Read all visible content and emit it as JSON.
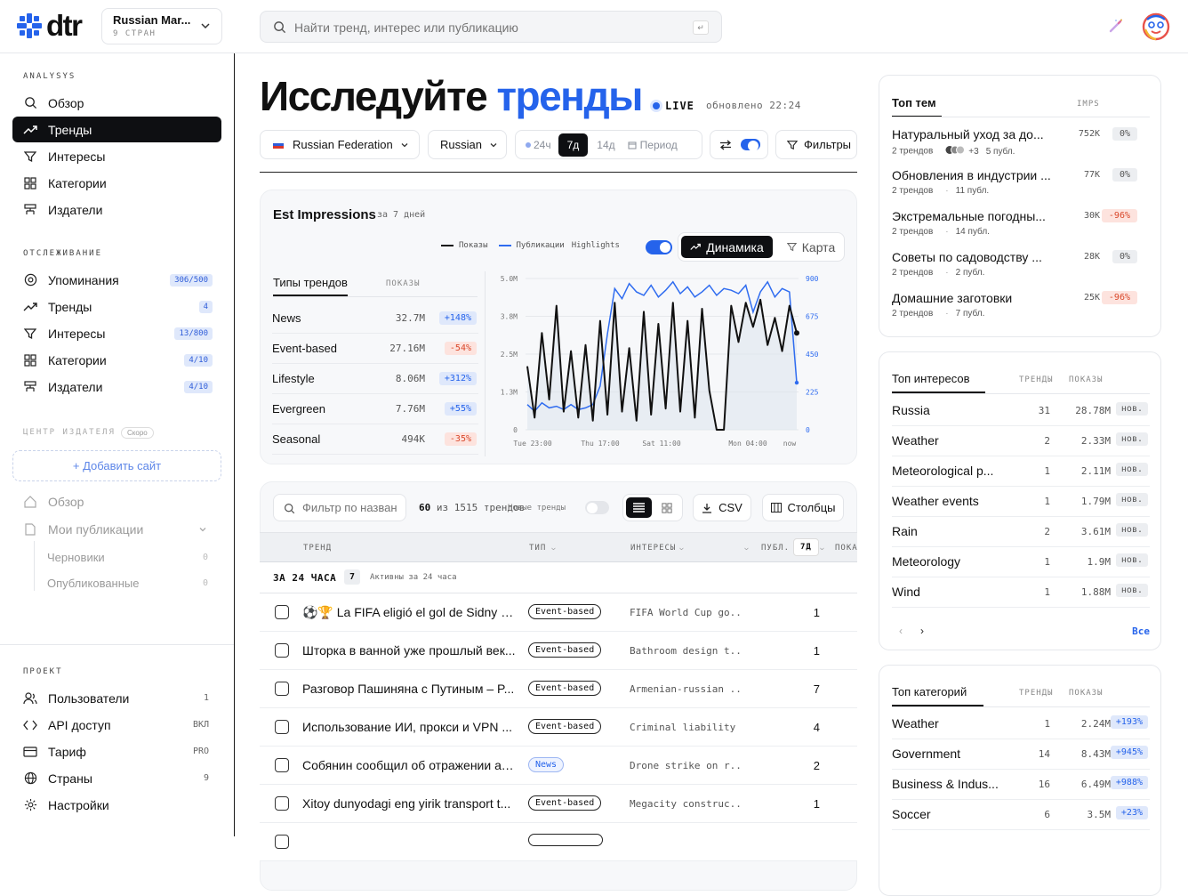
{
  "header": {
    "logo_text": "dtr",
    "project_name": "Russian Mar...",
    "project_sub": "9 СТРАН",
    "search_placeholder": "Найти тренд, интерес или публикацию",
    "search_kbd": "↵"
  },
  "sidebar": {
    "analysis_title": "ANALYSYS",
    "analysis": [
      {
        "label": "Обзор",
        "icon": "search-icon"
      },
      {
        "label": "Тренды",
        "icon": "trend-icon",
        "active": true
      },
      {
        "label": "Интересы",
        "icon": "filter-icon"
      },
      {
        "label": "Категории",
        "icon": "grid-icon"
      },
      {
        "label": "Издатели",
        "icon": "publisher-icon"
      }
    ],
    "tracking_title": "ОТСЛЕЖИВАНИЕ",
    "tracking": [
      {
        "label": "Упоминания",
        "badge": "306/500"
      },
      {
        "label": "Тренды",
        "badge": "4"
      },
      {
        "label": "Интересы",
        "badge": "13/800"
      },
      {
        "label": "Категории",
        "badge": "4/10"
      },
      {
        "label": "Издатели",
        "badge": "4/10"
      }
    ],
    "publisher_title": "ЦЕНТР ИЗДАТЕЛЯ",
    "publisher_soon": "Скоро",
    "add_site": "+ Добавить сайт",
    "pub_overview": "Обзор",
    "pub_my": "Мои публикации",
    "pub_drafts": "Черновики",
    "pub_drafts_count": "0",
    "pub_published": "Опубликованные",
    "pub_published_count": "0",
    "project_title": "ПРОЕКТ",
    "project": [
      {
        "label": "Пользователи",
        "meta": "1"
      },
      {
        "label": "API доступ",
        "meta": "ВКЛ"
      },
      {
        "label": "Тариф",
        "meta": "PRO"
      },
      {
        "label": "Страны",
        "meta": "9"
      },
      {
        "label": "Настройки",
        "meta": ""
      }
    ]
  },
  "main": {
    "title_a": "Исследуйте",
    "title_b": "тренды",
    "live": "LIVE",
    "updated": "обновлено 22:24",
    "country": "Russian Federation",
    "language": "Russian",
    "periods": [
      "24ч",
      "7д",
      "14д",
      "Период"
    ],
    "active_period": "7д",
    "filters": "Фильтры",
    "chart_card": {
      "title": "Est Impressions",
      "sub": "за 7 дней",
      "legend_shows": "Показы",
      "legend_pubs": "Публикации",
      "highlights": "Highlights",
      "btn_dynamics": "Динамика",
      "btn_map": "Карта",
      "types_tab": "Типы трендов",
      "types_col": "ПОКАЗЫ",
      "types": [
        {
          "name": "News",
          "value": "32.7M",
          "delta": "+148%",
          "dir": "up"
        },
        {
          "name": "Event-based",
          "value": "27.16M",
          "delta": "-54%",
          "dir": "dn"
        },
        {
          "name": "Lifestyle",
          "value": "8.06M",
          "delta": "+312%",
          "dir": "up"
        },
        {
          "name": "Evergreen",
          "value": "7.76M",
          "delta": "+55%",
          "dir": "up"
        },
        {
          "name": "Seasonal",
          "value": "494K",
          "delta": "-35%",
          "dir": "dn"
        }
      ]
    },
    "chart_data": {
      "type": "line",
      "y_left_ticks": [
        "5.0M",
        "3.8M",
        "2.5M",
        "1.3M",
        "0"
      ],
      "y_right_ticks": [
        "900",
        "675",
        "450",
        "225",
        "0"
      ],
      "x_ticks": [
        "Tue 23:00",
        "Thu 17:00",
        "Sat 11:00",
        "Mon 04:00",
        "now"
      ],
      "y_left_lim": [
        0,
        5000000
      ],
      "y_right_lim": [
        0,
        900
      ],
      "series": [
        {
          "name": "Показы",
          "axis": "left",
          "color": "#111111",
          "values": [
            2.1,
            0.4,
            3.2,
            1.0,
            4.1,
            0.6,
            2.6,
            0.4,
            2.8,
            0.3,
            3.6,
            0.5,
            4.2,
            0.6,
            2.7,
            0.3,
            3.9,
            0.5,
            3.5,
            0.7,
            4.2,
            0.6,
            3.6,
            0.4,
            4.0,
            1.3,
            0.0,
            0.0,
            4.1,
            2.9,
            4.2,
            3.4,
            4.3,
            2.8,
            3.7,
            2.6,
            4.1,
            3.2
          ]
        },
        {
          "name": "Публикации",
          "axis": "right",
          "color": "#2f6cf0",
          "values": [
            150,
            110,
            160,
            130,
            140,
            120,
            150,
            120,
            130,
            150,
            260,
            570,
            840,
            780,
            870,
            820,
            800,
            860,
            790,
            830,
            880,
            810,
            850,
            790,
            820,
            860,
            800,
            840,
            830,
            810,
            860,
            700,
            820,
            880,
            790,
            840,
            820,
            280
          ]
        }
      ]
    },
    "table": {
      "filter_placeholder": "Фильтр по назван",
      "count_a": "60",
      "count_mid": "из",
      "count_b": "1515",
      "count_label": "трендов",
      "new_trends": "Новые тренды",
      "csv": "CSV",
      "columns_btn": "Столбцы",
      "head_trend": "ТРЕНД",
      "head_type": "ТИП",
      "head_interests": "ИНТЕРЕСЫ",
      "head_pubs": "ПУБЛ.",
      "head_period": "7Д",
      "head_shows": "ПОКА",
      "group_label": "ЗА 24 ЧАСА",
      "group_count": "7",
      "group_sub": "Активны за 24 часа",
      "rows": [
        {
          "title": "⚽🏆 La FIFA eligió el gol de Sidny L...",
          "type": "Event-based",
          "interest": "FIFA World Cup go...",
          "pubs": "1"
        },
        {
          "title": "Шторка в ванной уже прошлый век...",
          "type": "Event-based",
          "interest": "Bathroom design t...",
          "pubs": "1"
        },
        {
          "title": "Разговор Пашиняна с Путиным – P...",
          "type": "Event-based",
          "interest": "Armenian-russian ...",
          "pubs": "7"
        },
        {
          "title": "Использование ИИ, прокси и VPN ...",
          "type": "Event-based",
          "interest": "Criminal liability",
          "pubs": "4"
        },
        {
          "title": "Собянин сообщил об отражении ат...",
          "type": "News",
          "interest": "Drone strike on r...",
          "pubs": "2"
        },
        {
          "title": "Xitoy dunyodagi eng yirik transport t...",
          "type": "Event-based",
          "interest": "Megacity construc...",
          "pubs": "1"
        }
      ]
    }
  },
  "right": {
    "topics": {
      "tab": "Топ тем",
      "col": "IMPS",
      "items": [
        {
          "title": "Натуральный уход за до...",
          "meta_a": "2 трендов",
          "meta_extra": "+3",
          "meta_b": "5 публ.",
          "imps": "752K",
          "delta": "0%",
          "dir": "gr"
        },
        {
          "title": "Обновления в индустрии ...",
          "meta_a": "2 трендов",
          "meta_extra": "",
          "meta_b": "11 публ.",
          "imps": "77K",
          "delta": "0%",
          "dir": "gr"
        },
        {
          "title": "Экстремальные погодны...",
          "meta_a": "2 трендов",
          "meta_extra": "",
          "meta_b": "14 публ.",
          "imps": "30K",
          "delta": "-96%",
          "dir": "dn"
        },
        {
          "title": "Советы по садоводству ...",
          "meta_a": "2 трендов",
          "meta_extra": "",
          "meta_b": "2 публ.",
          "imps": "28K",
          "delta": "0%",
          "dir": "gr"
        },
        {
          "title": "Домашние заготовки",
          "meta_a": "2 трендов",
          "meta_extra": "",
          "meta_b": "7 публ.",
          "imps": "25K",
          "delta": "-96%",
          "dir": "dn"
        }
      ]
    },
    "interests": {
      "tab": "Топ интересов",
      "col_trends": "ТРЕНДЫ",
      "col_shows": "ПОКАЗЫ",
      "all": "Все",
      "items": [
        {
          "name": "Russia",
          "trends": "31",
          "shows": "28.78M",
          "badge": "нов."
        },
        {
          "name": "Weather",
          "trends": "2",
          "shows": "2.33M",
          "badge": "нов."
        },
        {
          "name": "Meteorological p...",
          "trends": "1",
          "shows": "2.11M",
          "badge": "нов."
        },
        {
          "name": "Weather events",
          "trends": "1",
          "shows": "1.79M",
          "badge": "нов."
        },
        {
          "name": "Rain",
          "trends": "2",
          "shows": "3.61M",
          "badge": "нов."
        },
        {
          "name": "Meteorology",
          "trends": "1",
          "shows": "1.9M",
          "badge": "нов."
        },
        {
          "name": "Wind",
          "trends": "1",
          "shows": "1.88M",
          "badge": "нов."
        }
      ]
    },
    "categories": {
      "tab": "Топ категорий",
      "col_trends": "ТРЕНДЫ",
      "col_shows": "ПОКАЗЫ",
      "items": [
        {
          "name": "Weather",
          "trends": "1",
          "shows": "2.24M",
          "badge": "+193%"
        },
        {
          "name": "Government",
          "trends": "14",
          "shows": "8.43M",
          "badge": "+945%"
        },
        {
          "name": "Business & Indus...",
          "trends": "16",
          "shows": "6.49M",
          "badge": "+988%"
        },
        {
          "name": "Soccer",
          "trends": "6",
          "shows": "3.5M",
          "badge": "+23%"
        }
      ]
    }
  },
  "colors": {
    "accent": "#2563eb",
    "dark": "#0e0f12",
    "up_bg": "#dfe8fb",
    "down_bg": "#fde3de"
  }
}
